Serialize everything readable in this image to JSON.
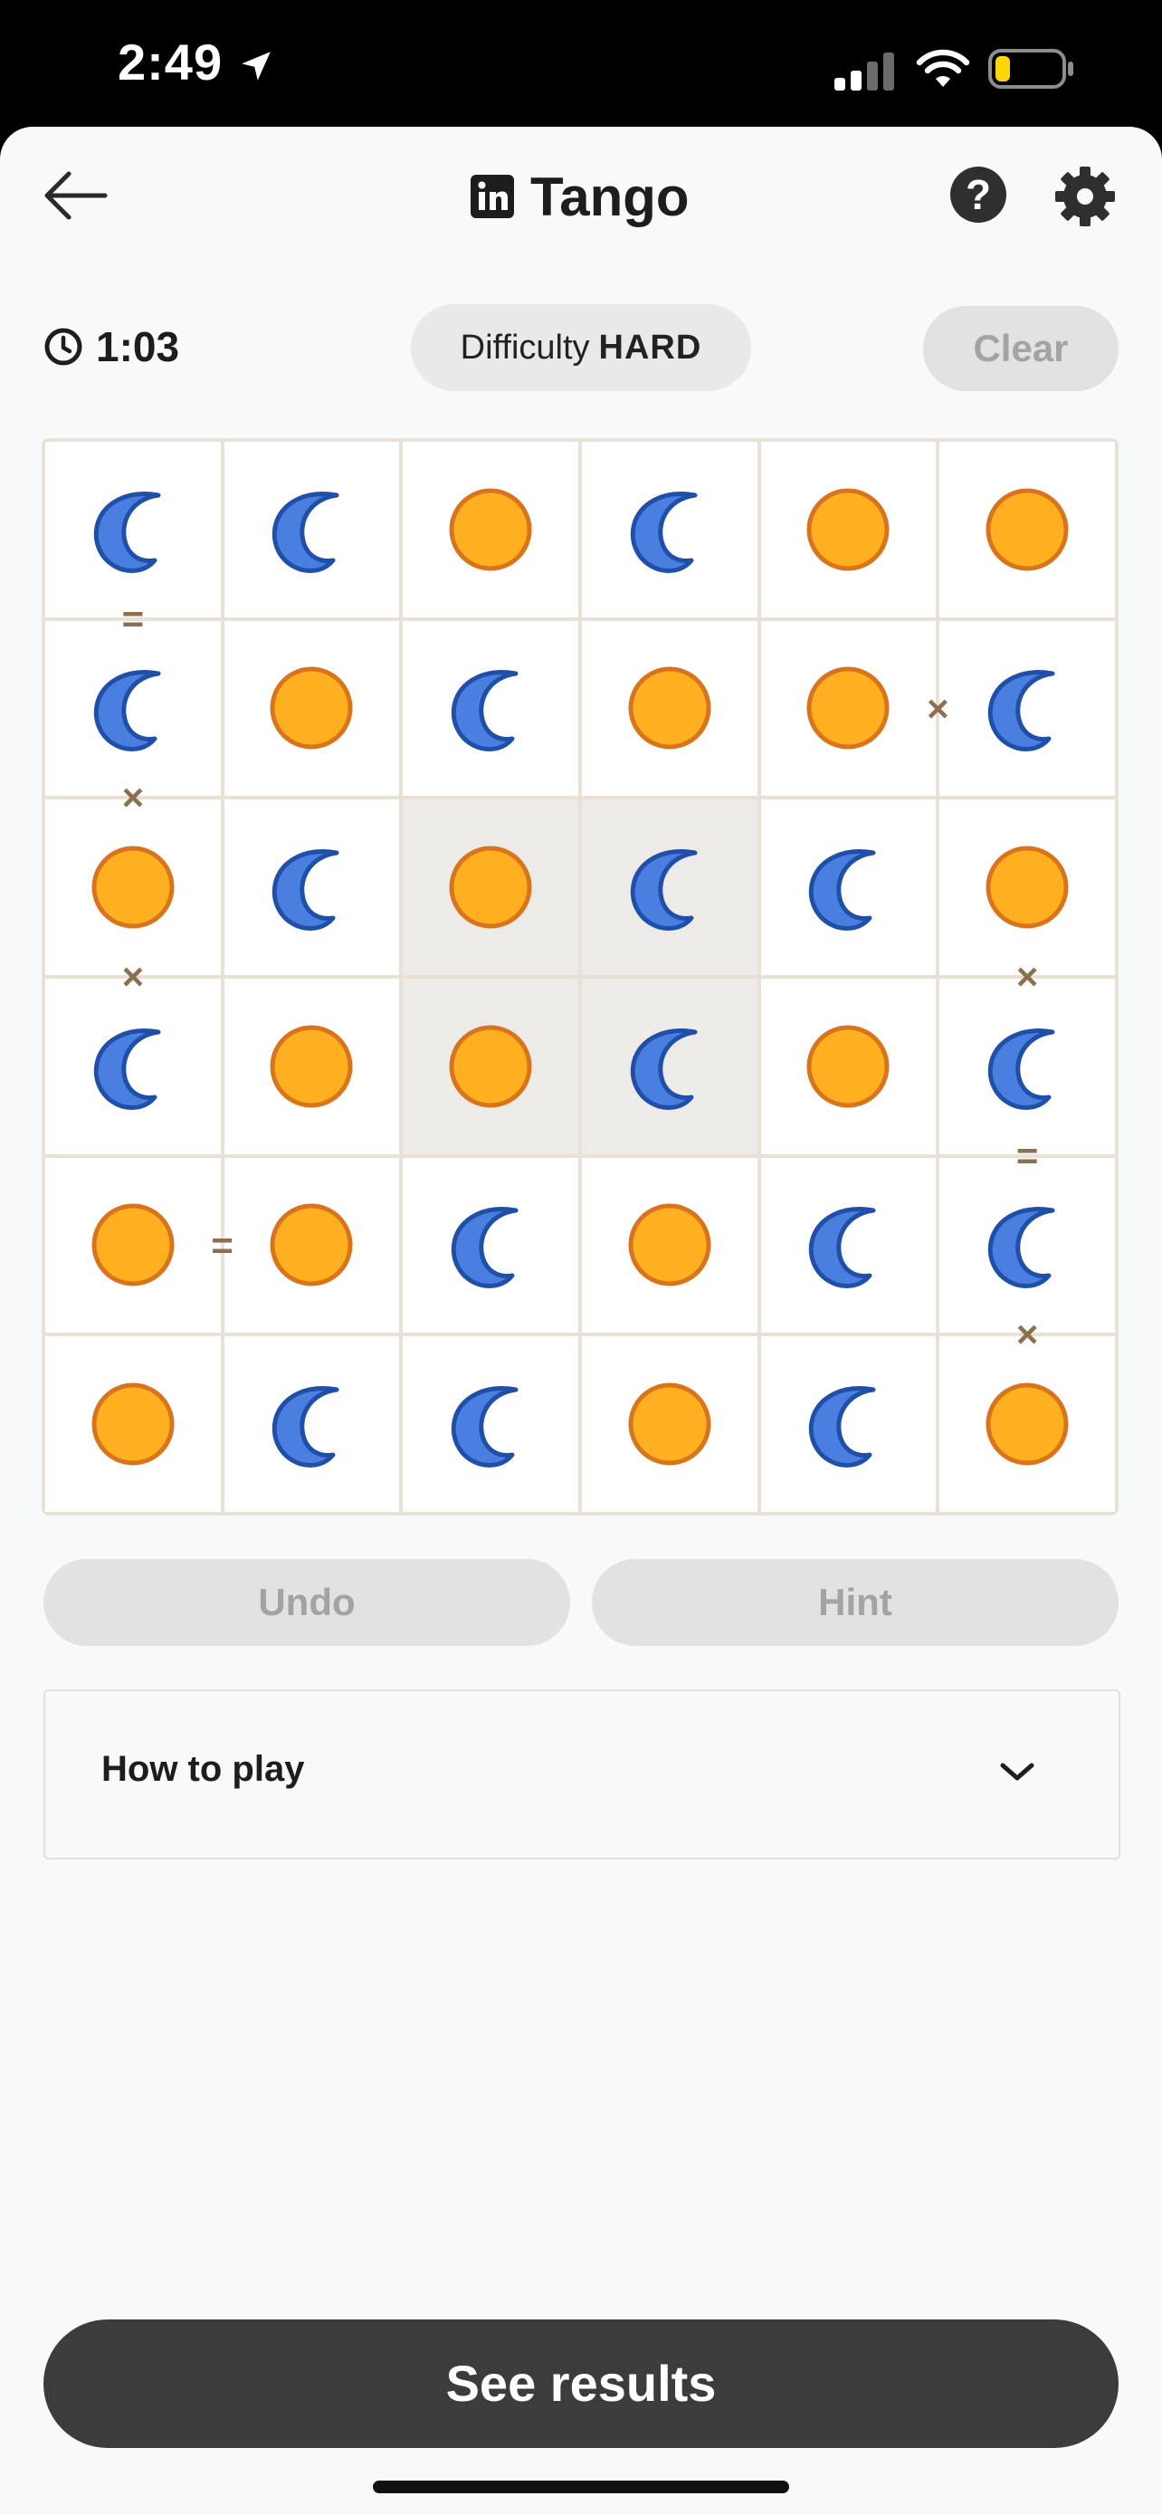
{
  "status_bar": {
    "time": "2:49"
  },
  "header": {
    "title": "Tango",
    "back_icon": "arrow-left-icon",
    "help_label": "?"
  },
  "toolbar": {
    "timer": "1:03",
    "difficulty_label": "Difficulty",
    "difficulty_value": "HARD",
    "clear_label": "Clear"
  },
  "colors": {
    "sun_fill": "#ffb020",
    "sun_stroke": "#d9741c",
    "moon_fill": "#4a7fe0",
    "moon_stroke": "#1f4fa8",
    "constraint": "#8b6f4e",
    "board_line": "#e9e1d6",
    "highlight": "#edebe7"
  },
  "board": {
    "size": 6,
    "cells": [
      [
        "moon",
        "moon",
        "sun",
        "moon",
        "sun",
        "sun"
      ],
      [
        "moon",
        "sun",
        "moon",
        "sun",
        "sun",
        "moon"
      ],
      [
        "sun",
        "moon",
        "sun",
        "moon",
        "moon",
        "sun"
      ],
      [
        "moon",
        "sun",
        "sun",
        "moon",
        "sun",
        "moon"
      ],
      [
        "sun",
        "sun",
        "moon",
        "sun",
        "moon",
        "moon"
      ],
      [
        "sun",
        "moon",
        "moon",
        "sun",
        "moon",
        "sun"
      ]
    ],
    "highlighted": [
      [
        2,
        2
      ],
      [
        2,
        3
      ],
      [
        3,
        2
      ],
      [
        3,
        3
      ]
    ],
    "constraints": [
      {
        "type": "=",
        "between": [
          [
            0,
            0
          ],
          [
            1,
            0
          ]
        ]
      },
      {
        "type": "×",
        "between": [
          [
            1,
            4
          ],
          [
            1,
            5
          ]
        ]
      },
      {
        "type": "×",
        "between": [
          [
            1,
            0
          ],
          [
            2,
            0
          ]
        ]
      },
      {
        "type": "×",
        "between": [
          [
            2,
            0
          ],
          [
            3,
            0
          ]
        ]
      },
      {
        "type": "×",
        "between": [
          [
            2,
            5
          ],
          [
            3,
            5
          ]
        ]
      },
      {
        "type": "=",
        "between": [
          [
            3,
            5
          ],
          [
            4,
            5
          ]
        ]
      },
      {
        "type": "=",
        "between": [
          [
            4,
            0
          ],
          [
            4,
            1
          ]
        ]
      },
      {
        "type": "×",
        "between": [
          [
            4,
            5
          ],
          [
            5,
            5
          ]
        ]
      }
    ]
  },
  "actions": {
    "undo_label": "Undo",
    "hint_label": "Hint"
  },
  "how_to_play": {
    "label": "How to play"
  },
  "footer": {
    "results_label": "See results"
  }
}
